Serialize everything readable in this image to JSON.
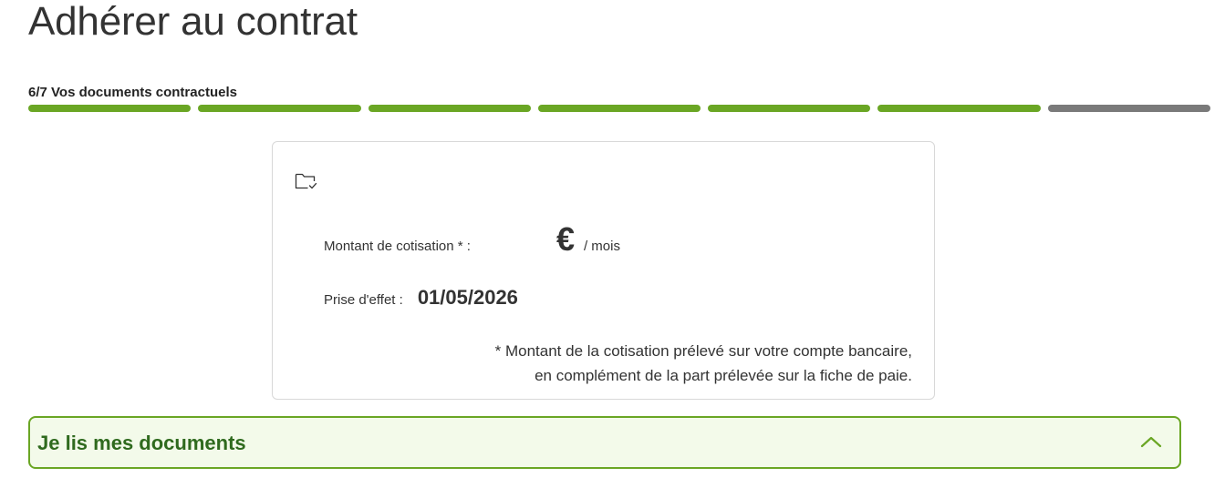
{
  "page": {
    "title": "Adhérer au contrat"
  },
  "stepper": {
    "label": "6/7 Vos documents contractuels",
    "current": 6,
    "total": 7,
    "colors": {
      "done": "#6aa624",
      "todo": "#7a7a7a"
    }
  },
  "summary_card": {
    "folder_icon": "folder-check-icon",
    "amount": {
      "label": "Montant de cotisation * :",
      "value": "",
      "currency": "€",
      "unit": "/ mois"
    },
    "effective_date": {
      "label": "Prise d'effet :",
      "value": "01/05/2026"
    },
    "note": {
      "line1": "* Montant de la cotisation prélevé sur votre compte bancaire,",
      "line2": "en complément de la part prélevée sur la fiche de paie."
    }
  },
  "documents_accordion": {
    "title": "Je lis mes documents",
    "icon": "chevron-up-icon",
    "expanded": true,
    "colors": {
      "border": "#6aa624",
      "background": "#f3faea",
      "title": "#2f6a1e"
    }
  }
}
